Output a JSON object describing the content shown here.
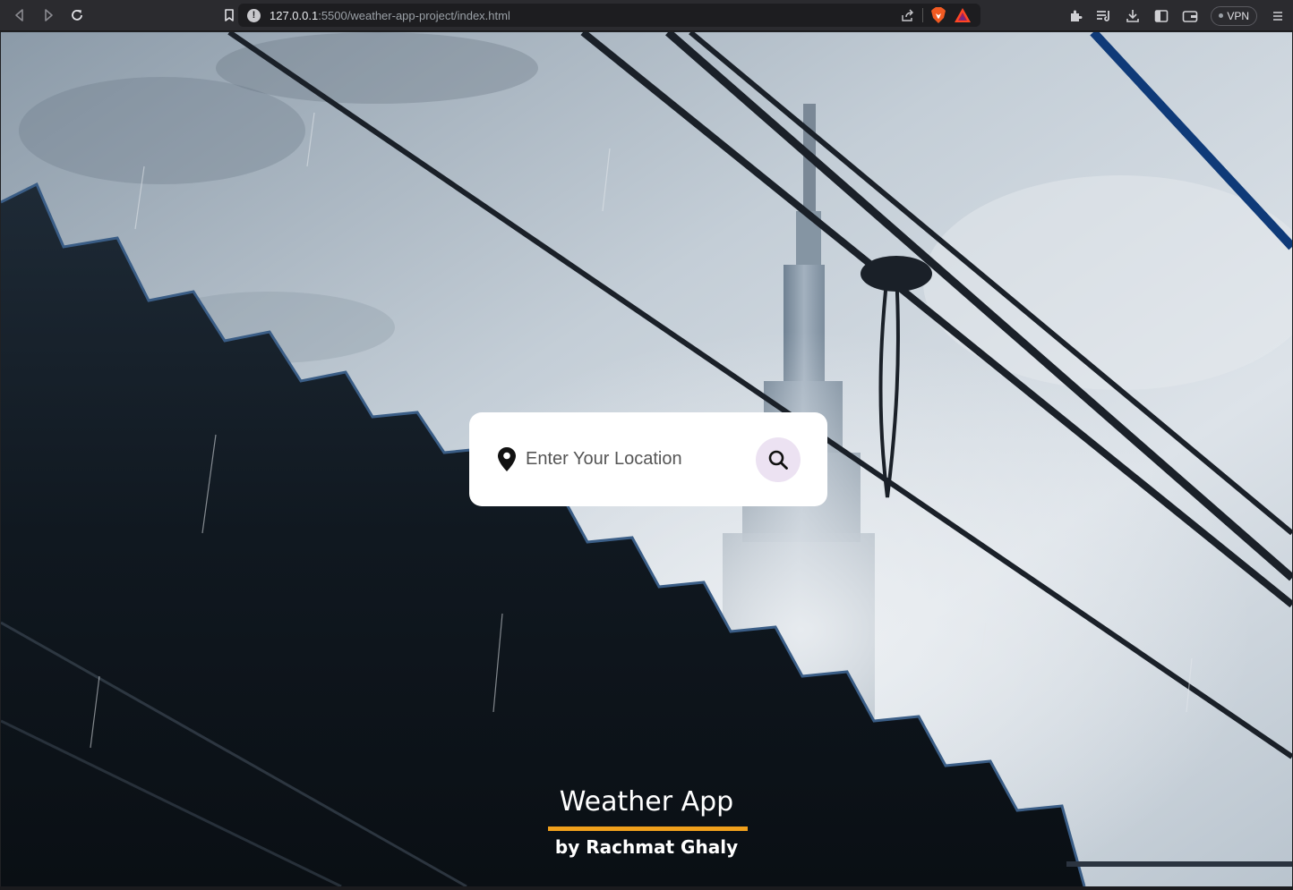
{
  "browser": {
    "url_host": "127.0.0.1",
    "url_path": ":5500/weather-app-project/index.html",
    "vpn_label": "VPN"
  },
  "search": {
    "placeholder": "Enter Your Location"
  },
  "footer": {
    "title": "Weather App",
    "author": "by Rachmat Ghaly",
    "accent_color": "#f0a01c"
  },
  "icons": {
    "location": "map-pin-icon",
    "search": "magnifier-icon"
  }
}
